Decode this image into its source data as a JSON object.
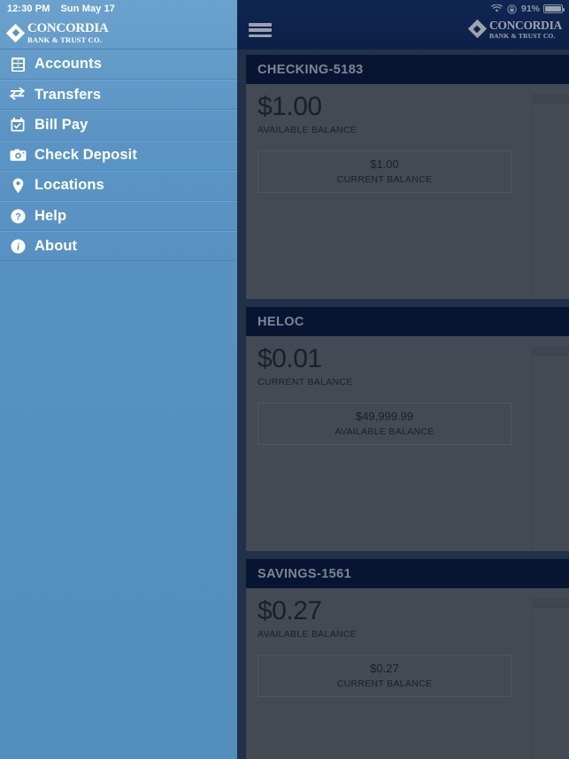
{
  "status_bar": {
    "time": "12:30 PM",
    "date": "Sun May 17",
    "wifi_icon": "wifi-icon",
    "rotation_lock_icon": "rotation-lock-icon",
    "battery_percent": "91%",
    "battery_icon": "battery-icon"
  },
  "brand": {
    "name": "CONCORDIA",
    "subtitle": "BANK & TRUST CO.",
    "logo_icon": "diamond-logo-icon"
  },
  "sidebar": {
    "items": [
      {
        "label": "Accounts",
        "icon": "accounts-cabinet-icon"
      },
      {
        "label": "Transfers",
        "icon": "transfer-arrows-icon"
      },
      {
        "label": "Bill Pay",
        "icon": "calendar-check-icon"
      },
      {
        "label": "Check Deposit",
        "icon": "camera-icon"
      },
      {
        "label": "Locations",
        "icon": "map-pin-icon"
      },
      {
        "label": "Help",
        "icon": "question-circle-icon"
      },
      {
        "label": "About",
        "icon": "info-circle-icon"
      }
    ]
  },
  "topbar": {
    "menu_icon": "hamburger-menu-icon"
  },
  "accounts": [
    {
      "title": "CHECKING-5183",
      "primary_amount": "$1.00",
      "primary_label": "AVAILABLE BALANCE",
      "secondary_amount": "$1.00",
      "secondary_label": "CURRENT BALANCE"
    },
    {
      "title": "HELOC",
      "primary_amount": "$0.01",
      "primary_label": "CURRENT BALANCE",
      "secondary_amount": "$49,999.99",
      "secondary_label": "AVAILABLE BALANCE"
    },
    {
      "title": "SAVINGS-1561",
      "primary_amount": "$0.27",
      "primary_label": "AVAILABLE BALANCE",
      "secondary_amount": "$0.27",
      "secondary_label": "CURRENT BALANCE"
    }
  ],
  "colors": {
    "sidebar_blue": "#5590c0",
    "header_navy": "#0b2257",
    "card_header_navy": "#000b2b",
    "card_body_gray": "#666666",
    "overlay_slate": "#2b3c52"
  }
}
